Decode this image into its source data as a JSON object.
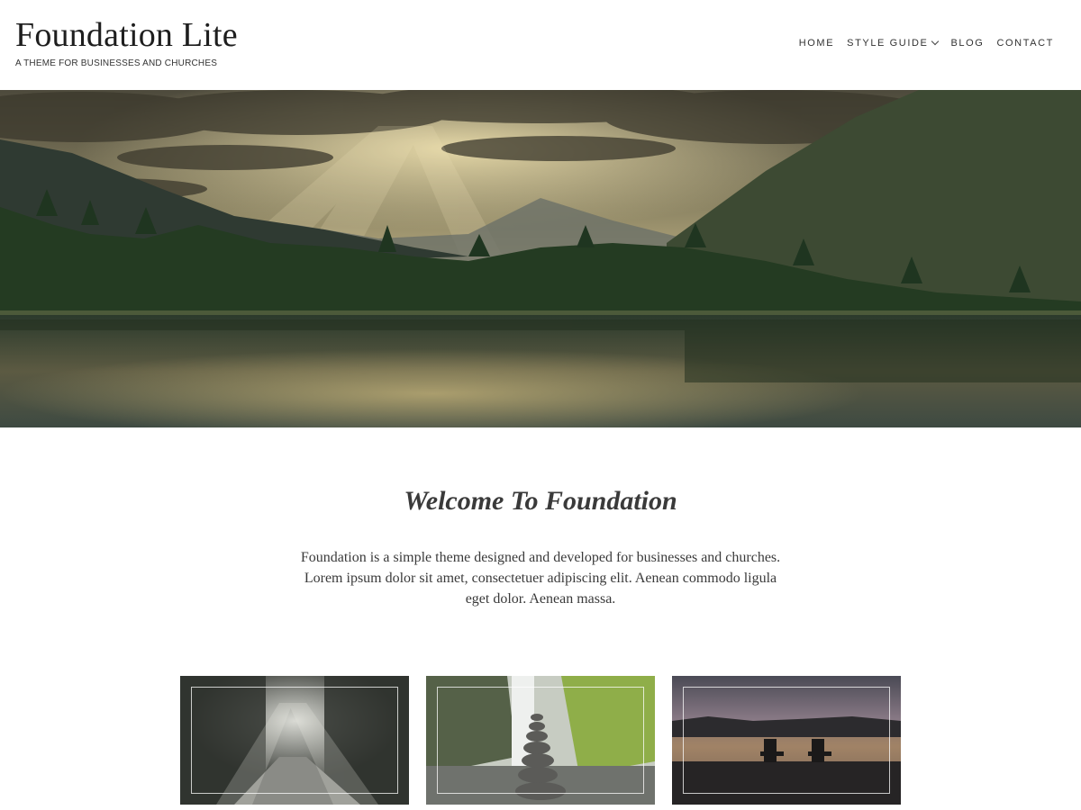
{
  "site": {
    "title": "Foundation Lite",
    "tagline": "A THEME FOR BUSINESSES AND CHURCHES"
  },
  "nav": {
    "items": [
      {
        "label": "HOME",
        "has_dropdown": false
      },
      {
        "label": "STYLE GUIDE",
        "has_dropdown": true
      },
      {
        "label": "BLOG",
        "has_dropdown": false
      },
      {
        "label": "CONTACT",
        "has_dropdown": false
      }
    ]
  },
  "hero": {
    "image": "mountain-lake-sunrays"
  },
  "welcome": {
    "title": "Welcome To Foundation",
    "text": "Foundation is a simple theme designed and developed for businesses and churches. Lorem ipsum dolor sit amet, consectetuer adipiscing elit. Aenean commodo ligula eget dolor. Aenean massa."
  },
  "cards": [
    {
      "image": "forest-road-light"
    },
    {
      "image": "stacked-stones-waterfall"
    },
    {
      "image": "lake-chairs-sunset"
    }
  ],
  "colors": {
    "text": "#333333",
    "title": "#1e1e1e",
    "background": "#ffffff"
  }
}
